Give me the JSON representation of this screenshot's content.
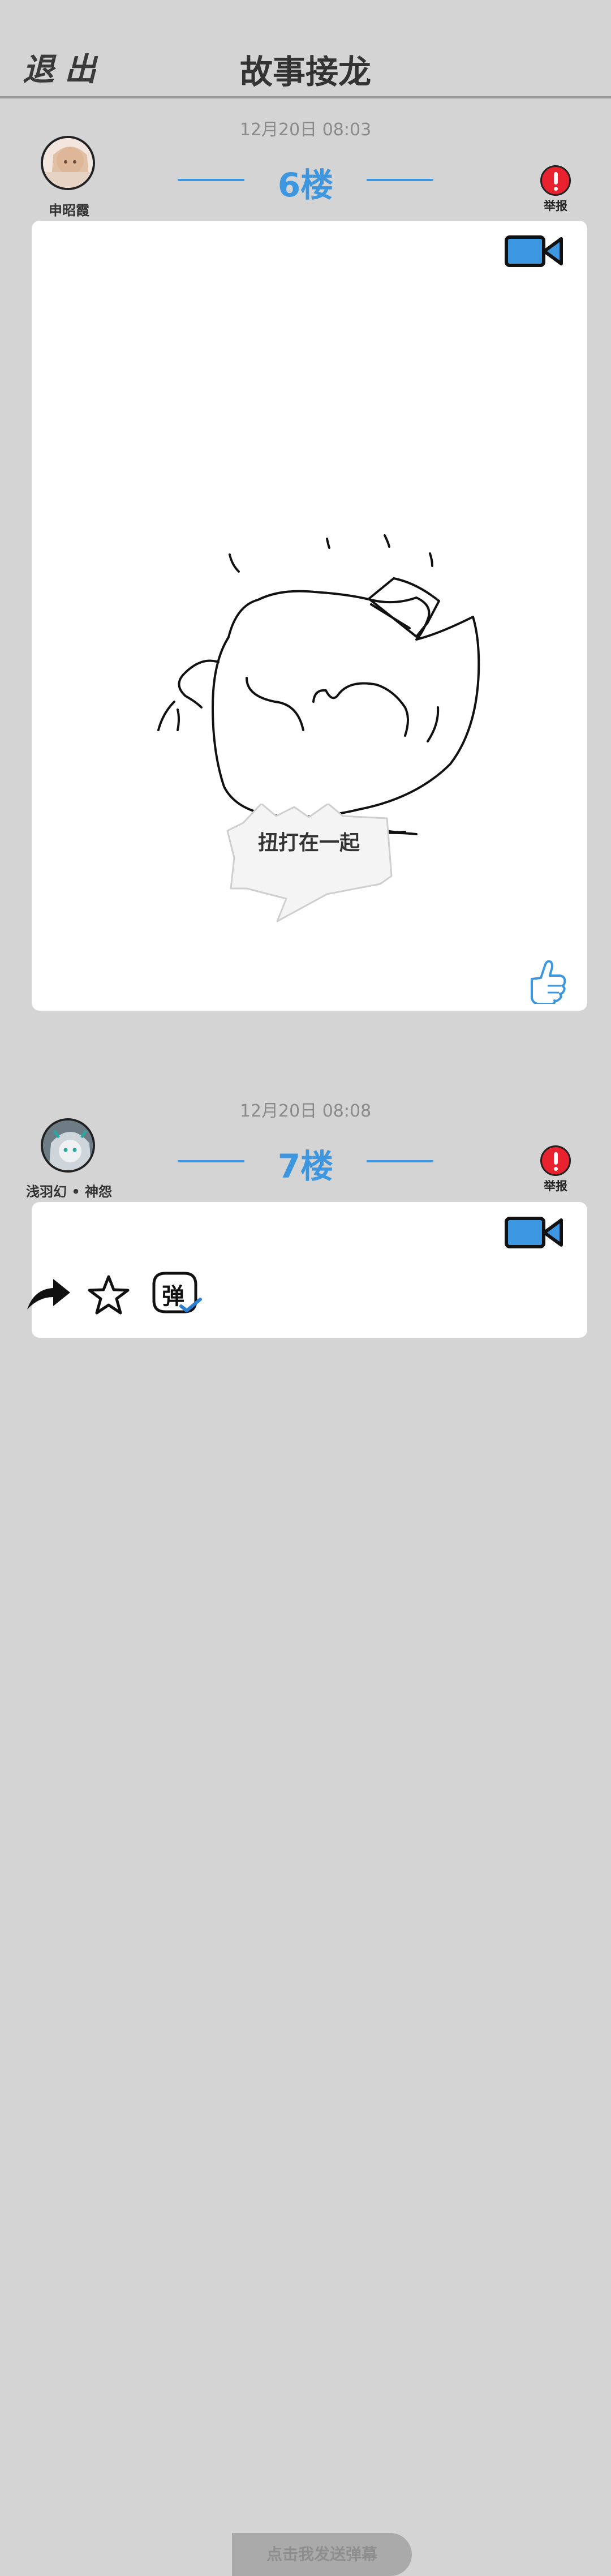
{
  "header": {
    "exit_label": "退出",
    "title": "故事接龙"
  },
  "posts": [
    {
      "time": "12月20日  08:03",
      "username": "申昭霞",
      "floor": "6楼",
      "report_label": "举报",
      "caption": "扭打在一起"
    },
    {
      "time": "12月20日  08:08",
      "username": "浅羽幻 • 神怨",
      "floor": "7楼",
      "report_label": "举报"
    }
  ],
  "bottom_bar": {
    "share_icon": "share-arrow-icon",
    "favorite_icon": "star-icon",
    "danmaku_icon": "danmaku-toggle-icon",
    "input_placeholder": "点击我发送弹幕"
  },
  "colors": {
    "accent": "#3d97e0",
    "background": "#d4d4d4",
    "report_red": "#e8232f"
  }
}
